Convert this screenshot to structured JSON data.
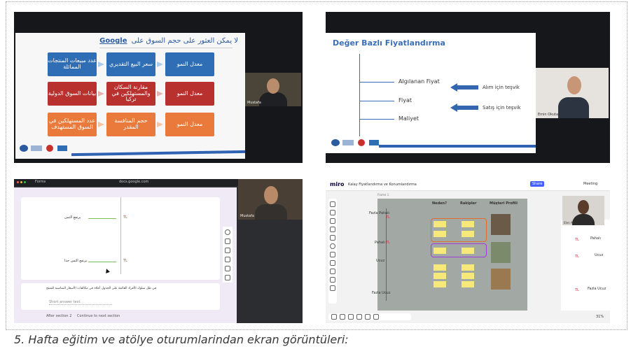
{
  "caption": "5. Hafta eğitim ve atölye oturumlarindan ekran görüntüleri:",
  "panel1": {
    "title_arabic": "لا يمكن العثور على حجم السوق على",
    "title_brand": "Google",
    "boxes": [
      {
        "text": "عدد مبيعات المنتجات المماثلة",
        "color": "#2f6db5"
      },
      {
        "text": "سعر البيع التقديري",
        "color": "#2f6db5"
      },
      {
        "text": "معدل النمو",
        "color": "#2f6db5"
      },
      {
        "text": "بيانات السوق الدولية",
        "color": "#b8312f"
      },
      {
        "text": "مقارنة السكان والمستهلكين في تركيا",
        "color": "#b8312f"
      },
      {
        "text": "معدل النمو",
        "color": "#b8312f"
      },
      {
        "text": "عدد المستهلكين في السوق المستهدف",
        "color": "#ea7a3b"
      },
      {
        "text": "حجم المنافسة المقدر",
        "color": "#ea7a3b"
      },
      {
        "text": "معدل النمو",
        "color": "#ea7a3b"
      }
    ],
    "cam_name": "Mustafa"
  },
  "panel2": {
    "title": "Değer Bazlı Fiyatlandırma",
    "labels": [
      "Algılanan Fiyat",
      "Fiyat",
      "Maliyet"
    ],
    "arrows": [
      "Alım için teşvik",
      "Satış için teşvik"
    ],
    "cam_name": "Emin Okutan"
  },
  "panel3": {
    "url": "docs.google.com",
    "tab": "Forms",
    "left_label_top": "يرتفع الثمن",
    "left_label_bottom": "يرتفع الثمن جدا",
    "tl_mark": "TL",
    "question": "في ظل سلوك الأفراد القائمة على الجدول أعلاه في مكالفات الأسعار المناسبة للمنتج",
    "answer_placeholder": "Short answer text",
    "section_footer": "After section 2",
    "section_action": "Continue to next section",
    "cam_name": "Mustafa"
  },
  "panel4": {
    "logo": "miro",
    "board_title": "Kalay Fiyatlandırma ve Konumlandırma",
    "frame_label": "Frame 1",
    "columns": [
      "Neden?",
      "Rakipler",
      "Müşteri Profili"
    ],
    "rows": [
      "Fazla Pahalı",
      "Pahalı",
      "Ucuz",
      "Fazla Ucuz"
    ],
    "right_rows": [
      "Pahalı",
      "Ucuz",
      "Fazla Ucuz"
    ],
    "tl_mark": "TL",
    "share_label": "Share",
    "meeting_label": "Meeting",
    "zoom": "31%",
    "cam_name": "Elen Ablaç",
    "accent": "#4262ff"
  }
}
